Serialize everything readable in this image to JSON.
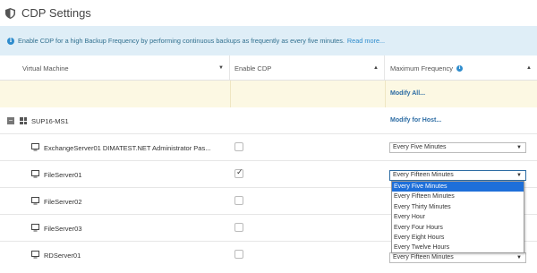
{
  "page": {
    "title": "CDP Settings"
  },
  "info": {
    "text": "Enable CDP for a high Backup Frequency by performing continuous backups as frequently as every five minutes.",
    "link": "Read more..."
  },
  "columns": {
    "vm": "Virtual Machine",
    "cdp": "Enable CDP",
    "freq": "Maximum Frequency"
  },
  "modify_all": "Modify All...",
  "host": {
    "name": "SUP16-MS1",
    "modify": "Modify for Host..."
  },
  "vms": [
    {
      "name": "ExchangeServer01 DIMATEST.NET Administrator Pas...",
      "cdp": false,
      "frequency": "Every Five Minutes"
    },
    {
      "name": "FileServer01",
      "cdp": true,
      "frequency": "Every Fifteen Minutes"
    },
    {
      "name": "FileServer02",
      "cdp": false,
      "frequency": ""
    },
    {
      "name": "FileServer03",
      "cdp": false,
      "frequency": ""
    },
    {
      "name": "RDServer01",
      "cdp": false,
      "frequency": "Every Fifteen Minutes"
    }
  ],
  "dropdown": {
    "options": [
      "Every Five Minutes",
      "Every Fifteen Minutes",
      "Every Thirty Minutes",
      "Every Hour",
      "Every Four Hours",
      "Every Eight Hours",
      "Every Twelve Hours"
    ],
    "highlighted_index": 0
  },
  "colors": {
    "info_bg": "#dfeef7",
    "highlight_row": "#fcf8e3",
    "link": "#2e6da4",
    "selection": "#1e6fd9"
  },
  "icons": {
    "title": "shield-icon",
    "info": "info-icon",
    "host": "windows-icon",
    "vm": "monitor-icon",
    "expander": "collapse-icon"
  }
}
